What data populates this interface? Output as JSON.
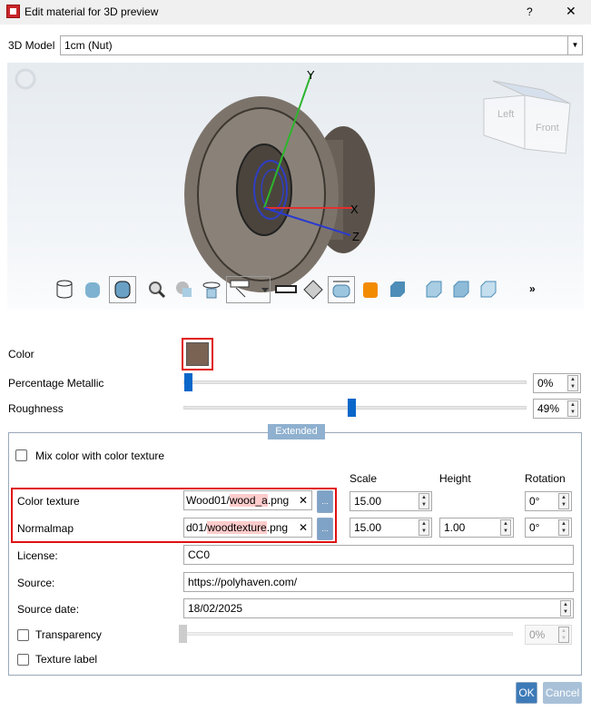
{
  "window": {
    "title": "Edit material for 3D preview",
    "help": "?",
    "close": "✕"
  },
  "model": {
    "label": "3D Model",
    "value": "1cm (Nut)"
  },
  "viewport": {
    "axis_y": "Y",
    "axis_x": "X",
    "axis_z": "Z",
    "cube_left": "Left",
    "cube_front": "Front",
    "more": "»",
    "toolbar": [
      "wireframe",
      "shaded",
      "shaded-with-edges",
      "zoom-fit",
      "section",
      "rotate-animation",
      "annotation-dropdown",
      "measure",
      "mesh",
      "dimension",
      "cut-view",
      "solid-box",
      "iso-view-1",
      "iso-view-2",
      "iso-view-3"
    ]
  },
  "material": {
    "color_label": "Color",
    "color_value": "#7b6354",
    "metallic_label": "Percentage Metallic",
    "metallic_value": "0%",
    "metallic_fraction": 0,
    "roughness_label": "Roughness",
    "roughness_value": "49%",
    "roughness_fraction": 0.49
  },
  "extended": {
    "tab": "Extended",
    "mix_label": "Mix color with color texture",
    "mix_checked": false,
    "headers": {
      "scale": "Scale",
      "height": "Height",
      "rotation": "Rotation"
    },
    "color_texture": {
      "label": "Color texture",
      "pre": "Wood01/",
      "hl": "wood_a",
      ".ext": ".png",
      "ext": ".png",
      "scale": "15.00",
      "rotation": "0°"
    },
    "normalmap": {
      "label": "Normalmap",
      "pre": "d01/",
      "hl": "woodtexture",
      "ext": ".png",
      "scale": "15.00",
      "height": "1.00",
      "rotation": "0°"
    },
    "clear": "✕",
    "browse": "...",
    "license_label": "License:",
    "license": "CC0",
    "source_label": "Source:",
    "source": "https://polyhaven.com/",
    "date_label": "Source date:",
    "date": "18/02/2025",
    "transparency_label": "Transparency",
    "transparency_value": "0%",
    "texture_label": "Texture label"
  },
  "buttons": {
    "ok": "OK",
    "cancel": "Cancel"
  }
}
